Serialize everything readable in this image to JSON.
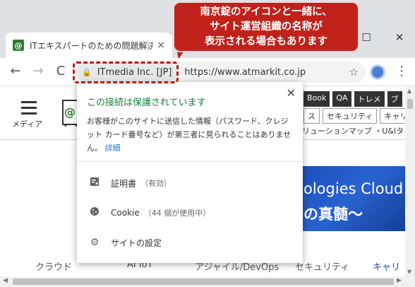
{
  "tab": {
    "favicon": "@",
    "title": "ITエキスパートのための問題解決メディア",
    "close": "×"
  },
  "window_controls": {
    "maximize": "☐",
    "close": "✕"
  },
  "toolbar": {
    "back": "←",
    "forward": "→",
    "reload": "C",
    "site_identity": "ITmedia Inc. [JP]",
    "url": "https://www.atmarkit.co.jp",
    "star": "☆",
    "menu": "⋮"
  },
  "callout": {
    "lines": [
      "南京錠のアイコンと一緒に、",
      "サイト運営組織の名称が",
      "表示される場合もあります"
    ],
    "color": "#c0211b"
  },
  "popup": {
    "close": "✕",
    "title": "この接続は保護されています",
    "description": "お客様がこのサイトに送信した情報（パスワード、クレジット カード番号など）が第三者に見られることはありません。",
    "details_link": "詳細",
    "items": [
      {
        "icon": "certificate-icon",
        "label": "証明書",
        "sub": "（有効）"
      },
      {
        "icon": "cookie-icon",
        "label": "Cookie",
        "sub": "（44 個が使用中）"
      },
      {
        "icon": "settings-icon",
        "label": "サイトの設定",
        "sub": ""
      }
    ],
    "title_color": "#188038"
  },
  "page": {
    "menu_label": "メディア",
    "logo": "@",
    "logo_dots": "• • •",
    "dark_tags": [
      "Book",
      "QA",
      "トレメ",
      "ブ"
    ],
    "light_tags": [
      "ス",
      "セキュリティ",
      "キャリア"
    ],
    "sub_links": "リューションマップ ・U&Iタ",
    "banner_line1": "ologies Cloud",
    "banner_line2": "の真髄～",
    "categories": [
      "クラウド",
      "AI IoT",
      "アジャイル/DevOps",
      "セキュリティ",
      "キャリ"
    ]
  }
}
